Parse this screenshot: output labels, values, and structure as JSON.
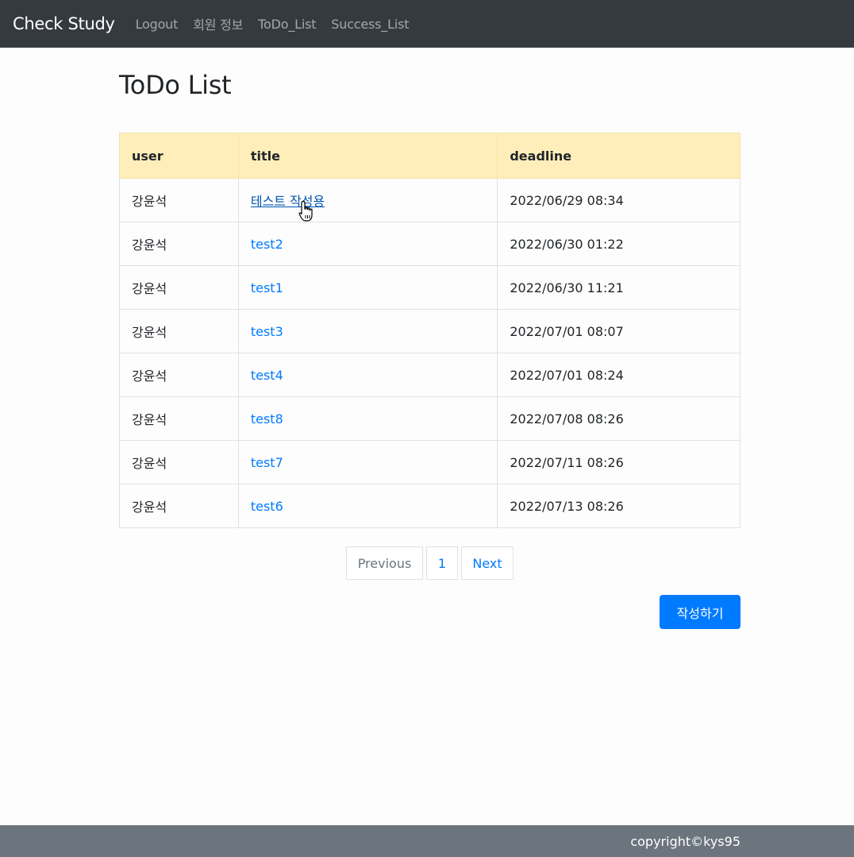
{
  "navbar": {
    "brand": "Check Study",
    "links": [
      "Logout",
      "회원 정보",
      "ToDo_List",
      "Success_List"
    ]
  },
  "page": {
    "title": "ToDo List"
  },
  "table": {
    "headers": [
      "user",
      "title",
      "deadline"
    ],
    "rows": [
      {
        "user": "강윤석",
        "title": "테스트 작성용",
        "deadline": "2022/06/29 08:34"
      },
      {
        "user": "강윤석",
        "title": "test2",
        "deadline": "2022/06/30 01:22"
      },
      {
        "user": "강윤석",
        "title": "test1",
        "deadline": "2022/06/30 11:21"
      },
      {
        "user": "강윤석",
        "title": "test3",
        "deadline": "2022/07/01 08:07"
      },
      {
        "user": "강윤석",
        "title": "test4",
        "deadline": "2022/07/01 08:24"
      },
      {
        "user": "강윤석",
        "title": "test8",
        "deadline": "2022/07/08 08:26"
      },
      {
        "user": "강윤석",
        "title": "test7",
        "deadline": "2022/07/11 08:26"
      },
      {
        "user": "강윤석",
        "title": "test6",
        "deadline": "2022/07/13 08:26"
      }
    ]
  },
  "pagination": {
    "previous": "Previous",
    "current": "1",
    "next": "Next"
  },
  "actions": {
    "write_label": "작성하기"
  },
  "footer": {
    "copyright": "copyright©kys95"
  },
  "colors": {
    "navbar_bg": "#343a40",
    "table_header_bg": "#ffeeba",
    "link": "#007bff",
    "primary_button": "#007bff",
    "footer_bg": "#6c757d"
  },
  "icons": {
    "cursor": "hand-pointer-cursor-icon"
  }
}
